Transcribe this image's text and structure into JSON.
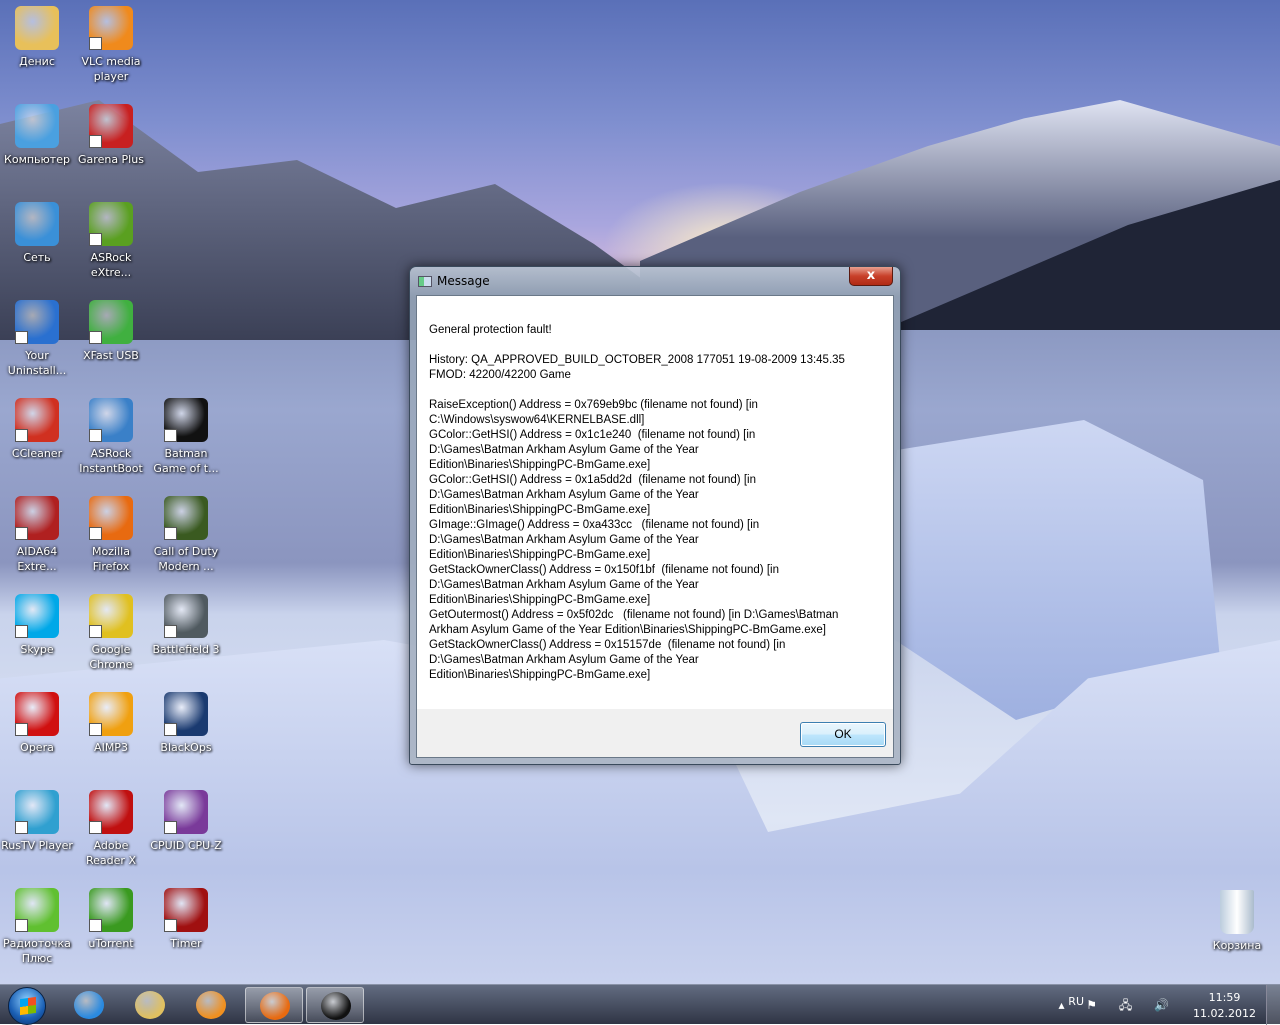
{
  "desktop": {
    "icons": [
      {
        "label": "Денис",
        "color": "#e8c05a"
      },
      {
        "label": "VLC media player",
        "color": "#f08a1c"
      },
      {
        "label": "Компьютер",
        "color": "#4aa0e0"
      },
      {
        "label": "Garena Plus",
        "color": "#c82020"
      },
      {
        "label": "Сеть",
        "color": "#3a90d8"
      },
      {
        "label": "ASRock eXtre...",
        "color": "#5aa020"
      },
      {
        "label": "Your Uninstall...",
        "color": "#2a70d0"
      },
      {
        "label": "XFast USB",
        "color": "#40b040"
      },
      {
        "label": "CCleaner",
        "color": "#d03020"
      },
      {
        "label": "ASRock InstantBoot",
        "color": "#3a80c8"
      },
      {
        "label": "Batman Game of t...",
        "color": "#111111"
      },
      {
        "label": "AIDA64 Extre...",
        "color": "#b02020"
      },
      {
        "label": "Mozilla Firefox",
        "color": "#e86a10"
      },
      {
        "label": "Call of Duty Modern ...",
        "color": "#3a5a20"
      },
      {
        "label": "Skype",
        "color": "#00a8e8"
      },
      {
        "label": "Google Chrome",
        "color": "#e0c020"
      },
      {
        "label": "Battlefield 3",
        "color": "#505a60"
      },
      {
        "label": "Opera",
        "color": "#d01010"
      },
      {
        "label": "AIMP3",
        "color": "#f0a010"
      },
      {
        "label": "BlackOps",
        "color": "#1a3a70"
      },
      {
        "label": "RusTV Player",
        "color": "#30a0d0"
      },
      {
        "label": "Adobe Reader X",
        "color": "#c01010"
      },
      {
        "label": "CPUID CPU-Z",
        "color": "#7a3a9a"
      },
      {
        "label": "Радиоточка Плюс",
        "color": "#60c030"
      },
      {
        "label": "uTorrent",
        "color": "#3a9a20"
      },
      {
        "label": "Timer",
        "color": "#a01010"
      }
    ],
    "recycle_bin": "Корзина"
  },
  "dialog": {
    "title": "Message",
    "close_glyph": "x",
    "message_lines": [
      "General protection fault!",
      "",
      "History: QA_APPROVED_BUILD_OCTOBER_2008 177051 19-08-2009 13:45.35",
      "FMOD: 42200/42200 Game",
      "",
      "RaiseException() Address = 0x769eb9bc (filename not found) [in",
      "C:\\Windows\\syswow64\\KERNELBASE.dll]",
      "GColor::GetHSI() Address = 0x1c1e240  (filename not found) [in",
      "D:\\Games\\Batman Arkham Asylum Game of the Year",
      "Edition\\Binaries\\ShippingPC-BmGame.exe]",
      "GColor::GetHSI() Address = 0x1a5dd2d  (filename not found) [in",
      "D:\\Games\\Batman Arkham Asylum Game of the Year",
      "Edition\\Binaries\\ShippingPC-BmGame.exe]",
      "GImage::GImage() Address = 0xa433cc   (filename not found) [in",
      "D:\\Games\\Batman Arkham Asylum Game of the Year",
      "Edition\\Binaries\\ShippingPC-BmGame.exe]",
      "GetStackOwnerClass() Address = 0x150f1bf  (filename not found) [in",
      "D:\\Games\\Batman Arkham Asylum Game of the Year",
      "Edition\\Binaries\\ShippingPC-BmGame.exe]",
      "GetOutermost() Address = 0x5f02dc   (filename not found) [in D:\\Games\\Batman",
      "Arkham Asylum Game of the Year Edition\\Binaries\\ShippingPC-BmGame.exe]",
      "GetStackOwnerClass() Address = 0x15157de  (filename not found) [in",
      "D:\\Games\\Batman Arkham Asylum Game of the Year",
      "Edition\\Binaries\\ShippingPC-BmGame.exe]"
    ],
    "ok_label": "OK"
  },
  "taskbar": {
    "items": [
      {
        "name": "internet-explorer",
        "color": "#2a8ae0",
        "active": false
      },
      {
        "name": "windows-explorer",
        "color": "#e0c060",
        "active": false
      },
      {
        "name": "media-player",
        "color": "#f09020",
        "active": false
      },
      {
        "name": "firefox",
        "color": "#e86a10",
        "active": true
      },
      {
        "name": "batman-game",
        "color": "#111111",
        "active": true
      }
    ],
    "language": "RU",
    "tray_icons": "▴ ⚑ 🖧 🔊",
    "time": "11:59",
    "date": "11.02.2012"
  }
}
